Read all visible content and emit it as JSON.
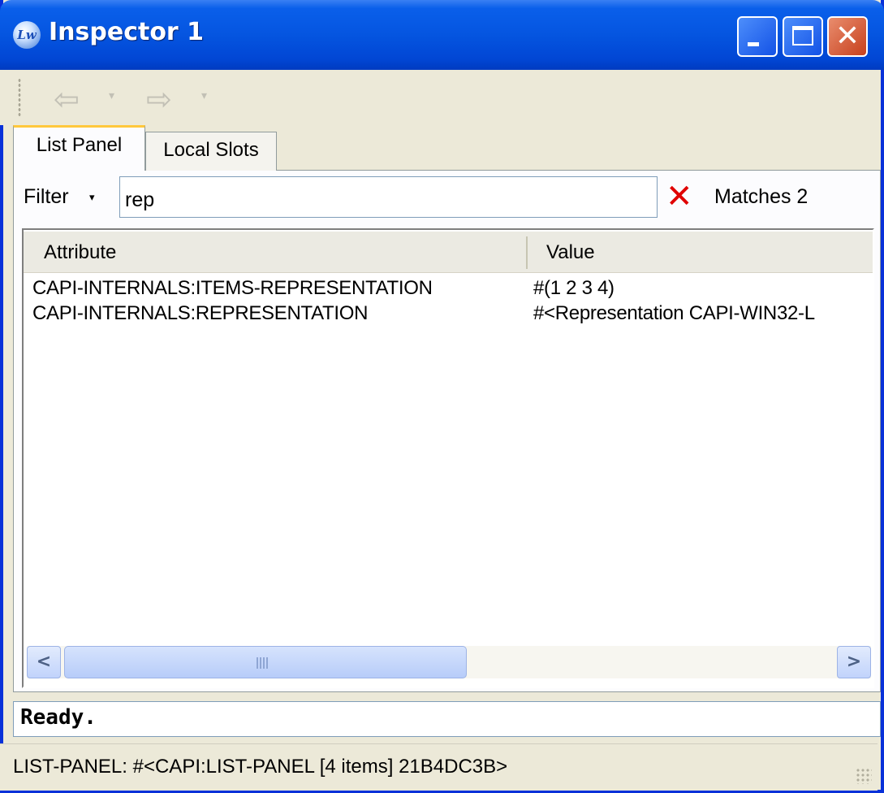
{
  "window": {
    "title": "Inspector 1",
    "app_icon_text": "Lw",
    "close_glyph": "✕"
  },
  "toolbar": {
    "back_glyph": "⇦",
    "forward_glyph": "⇨",
    "dropdown_glyph": "▾"
  },
  "tabs": [
    {
      "label": "List Panel",
      "active": true
    },
    {
      "label": "Local Slots",
      "active": false
    }
  ],
  "filter": {
    "label": "Filter",
    "dropdown_glyph": "▾",
    "value": "rep",
    "clear_glyph": "✕",
    "matches_text": "Matches 2"
  },
  "list": {
    "columns": [
      "Attribute",
      "Value"
    ],
    "rows": [
      {
        "attribute": "CAPI-INTERNALS:ITEMS-REPRESENTATION",
        "value": "#(1 2 3 4)"
      },
      {
        "attribute": "CAPI-INTERNALS:REPRESENTATION",
        "value": "#<Representation CAPI-WIN32-L"
      }
    ]
  },
  "scrollbar": {
    "left_glyph": "<",
    "right_glyph": ">"
  },
  "output": {
    "text": "Ready."
  },
  "status": {
    "text": "LIST-PANEL: #<CAPI:LIST-PANEL [4 items] 21B4DC3B>"
  },
  "colors": {
    "titlebar": "#0555E0",
    "face": "#ECE9D8",
    "tab_highlight": "#FFC83C",
    "clear_icon": "#E00000"
  }
}
